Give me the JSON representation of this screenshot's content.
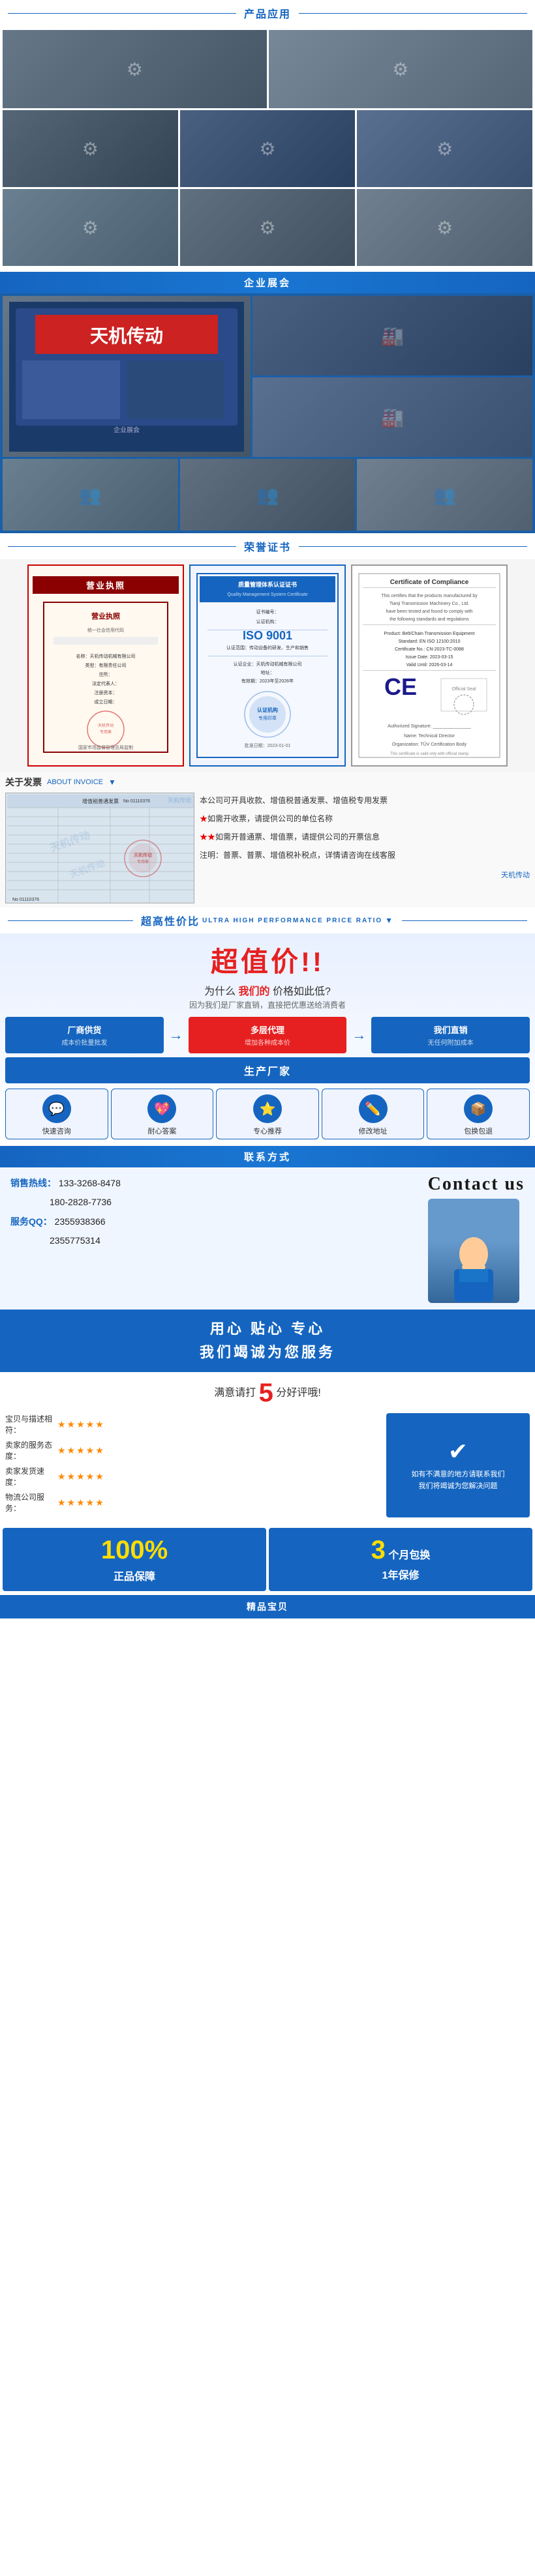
{
  "sections": {
    "product_apps": {
      "header": "产品应用",
      "images": [
        {
          "id": "app1",
          "alt": "机器1",
          "class": "img-grad-1"
        },
        {
          "id": "app2",
          "alt": "机器2",
          "class": "img-grad-2"
        },
        {
          "id": "app3",
          "alt": "机器3",
          "class": "img-grad-3"
        },
        {
          "id": "app4",
          "alt": "机器4",
          "class": "img-grad-4"
        },
        {
          "id": "app5",
          "alt": "机器5",
          "class": "img-grad-5"
        },
        {
          "id": "app6",
          "alt": "机器6",
          "class": "img-grad-6"
        },
        {
          "id": "app7",
          "alt": "机器7",
          "class": "img-grad-7"
        },
        {
          "id": "app8",
          "alt": "机器8",
          "class": "img-grad-8"
        }
      ]
    },
    "exhibition": {
      "header": "企业展会"
    },
    "honors": {
      "header": "荣誉证书",
      "certs": [
        {
          "id": "cert1",
          "title": "营业执照",
          "type": "red"
        },
        {
          "id": "cert2",
          "title": "质量管理体系认证证书",
          "type": "iso"
        },
        {
          "id": "cert3",
          "title": "Certificate of Compliance",
          "type": "ce"
        }
      ]
    },
    "invoice": {
      "header": "关于发票",
      "header_en": "ABOUT INVOICE",
      "arrow": "▼",
      "points": [
        "本公司可开具收款、增值税普通发票、增值税专用发票",
        "★如需开收票，请提供公司的单位名称",
        "★★如需开普通票、增值票，请提供公司的开票信息",
        "注明：普票、增值税补税点，详情请咨询在线客服"
      ],
      "watermark_top": "天机传动",
      "watermark_bottom": "天机传动"
    },
    "super_value": {
      "header": "超高性价比",
      "header_en": "ULTRA HIGH PERFORMANCE PRICE RATIO",
      "main_title": "超值价!!",
      "sub_title": "为什么 我们的 价格如此低?",
      "reason": "因为我们是厂家直销，直接把优惠送给消费者",
      "boxes": [
        {
          "title": "厂商供货",
          "subtitle": "成本价批量批发",
          "arrow": "→"
        },
        {
          "title": "多层代理",
          "subtitle": "增加各种成本价",
          "arrow": "→"
        },
        {
          "title": "我们直销",
          "subtitle": "无任何附加成本"
        }
      ],
      "factory_label": "生产厂家",
      "services": [
        {
          "icon": "💬",
          "label": "快速咨询"
        },
        {
          "icon": "💖",
          "label": "耐心答案"
        },
        {
          "icon": "⭐",
          "label": "专心推荐"
        },
        {
          "icon": "✏️",
          "label": "修改地址"
        },
        {
          "icon": "📦",
          "label": "包换包退"
        }
      ]
    },
    "contact": {
      "header": "联系方式",
      "sales_label": "销售热线：",
      "sales_phone1": "133-3268-8478",
      "sales_phone2": "180-2828-7736",
      "qq_label": "服务QQ：",
      "qq1": "2355938366",
      "qq2": "2355775314",
      "contact_us": "Contact us"
    },
    "slogan": {
      "line1_pre": "用心 贴心 专心",
      "line2": "我们竭诚为您服务"
    },
    "rating": {
      "title_pre": "满意请打",
      "num": "5",
      "title_post": "分好评哦!",
      "rows": [
        {
          "label": "宝贝与描述相符：",
          "stars": "★★★★★"
        },
        {
          "label": "卖家的服务态度：",
          "stars": "★★★★★"
        },
        {
          "label": "卖家发货速度：",
          "stars": "★★★★★"
        },
        {
          "label": "物流公司服务：",
          "stars": "★★★★★"
        }
      ],
      "right_text": "如有不满意的地方请联系我们\n我们将竭诚为您解决问题"
    },
    "guarantee": {
      "boxes": [
        {
          "num": "100",
          "pct": "%",
          "label": "正品保障"
        },
        {
          "num": "3",
          "unit": "个月包换\n1年保修",
          "label": ""
        }
      ]
    },
    "footer": {
      "label": "精品宝贝"
    }
  }
}
